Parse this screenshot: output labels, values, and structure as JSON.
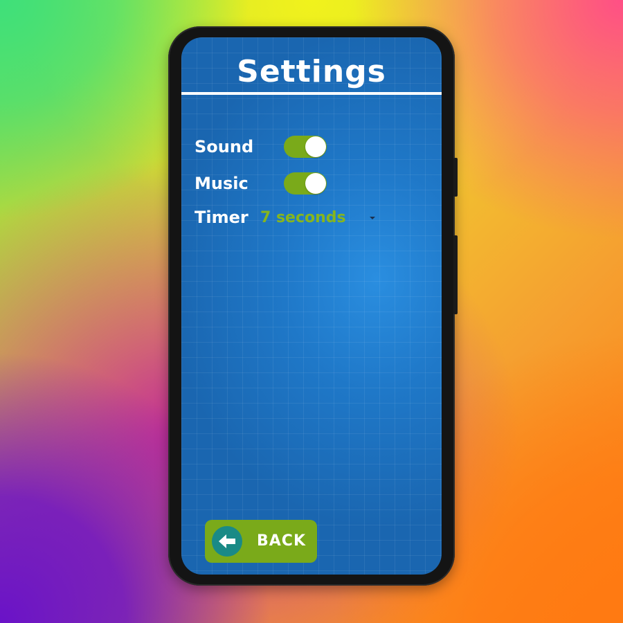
{
  "header": {
    "title": "Settings"
  },
  "settings": {
    "sound": {
      "label": "Sound",
      "enabled": true
    },
    "music": {
      "label": "Music",
      "enabled": true
    },
    "timer": {
      "label": "Timer",
      "value": "7 seconds"
    }
  },
  "footer": {
    "back_label": "BACK"
  },
  "colors": {
    "screen_blue": "#1f78c8",
    "accent_green": "#7aaa1a",
    "back_icon_teal": "#1a8a86",
    "text_white": "#ffffff"
  },
  "icons": {
    "back": "arrow-left-icon",
    "dropdown": "caret-down-icon"
  }
}
